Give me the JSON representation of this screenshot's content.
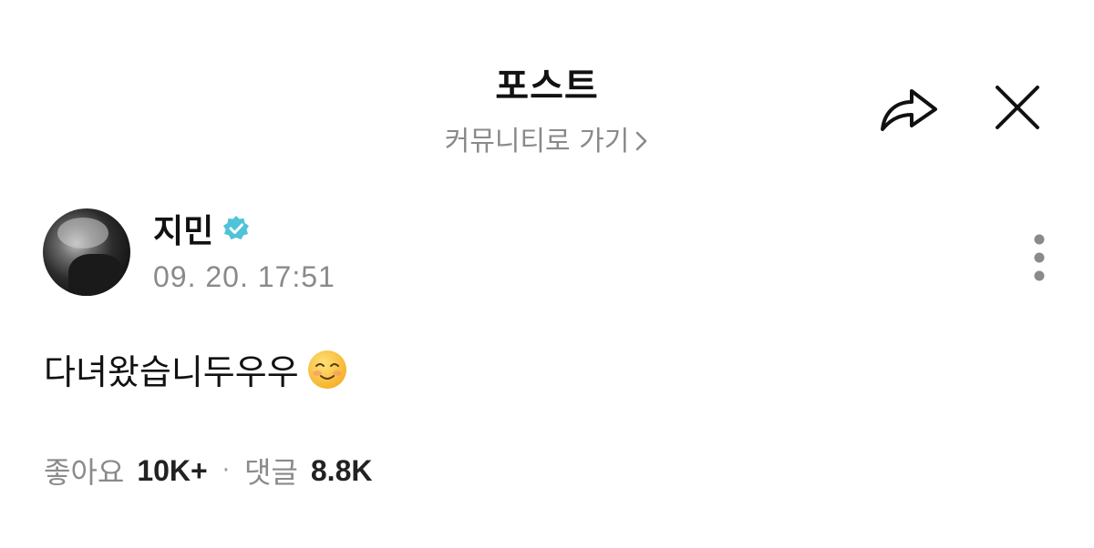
{
  "header": {
    "title": "포스트",
    "community_link": "커뮤니티로 가기",
    "share_icon": "share-arrow-icon",
    "close_icon": "close-icon"
  },
  "post": {
    "author": "지민",
    "verified_icon": "verified-badge-icon",
    "verified_color": "#4fc3d7",
    "timestamp": "09. 20. 17:51",
    "text": "다녀왔습니두우우",
    "emoji": "smiling-face-emoji",
    "more_icon": "more-vertical-icon"
  },
  "stats": {
    "likes_label": "좋아요",
    "likes_value": "10K+",
    "separator": "·",
    "comments_label": "댓글",
    "comments_value": "8.8K"
  }
}
